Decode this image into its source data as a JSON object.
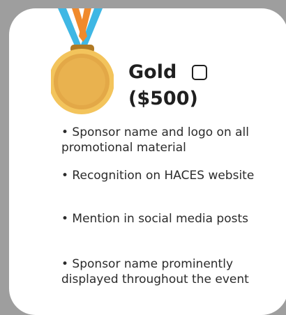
{
  "tier": {
    "name": "Gold",
    "price": "($500)",
    "selected": false,
    "medal_icon": "gold-medal-icon",
    "colors": {
      "medal_gold": "#e7b04e",
      "medal_inner": "#e0a845",
      "ribbon_blue": "#3fb7e4",
      "ribbon_orange": "#f08a2c",
      "card_background": "#ffffff",
      "page_background": "#9e9e9e"
    }
  },
  "benefits": [
    {
      "text": "• Sponsor name and logo on all promotional material"
    },
    {
      "text": "• Recognition on HACES website"
    },
    {
      "text": "• Mention in social media posts"
    },
    {
      "text": "• Sponsor name prominently displayed throughout the event"
    }
  ]
}
